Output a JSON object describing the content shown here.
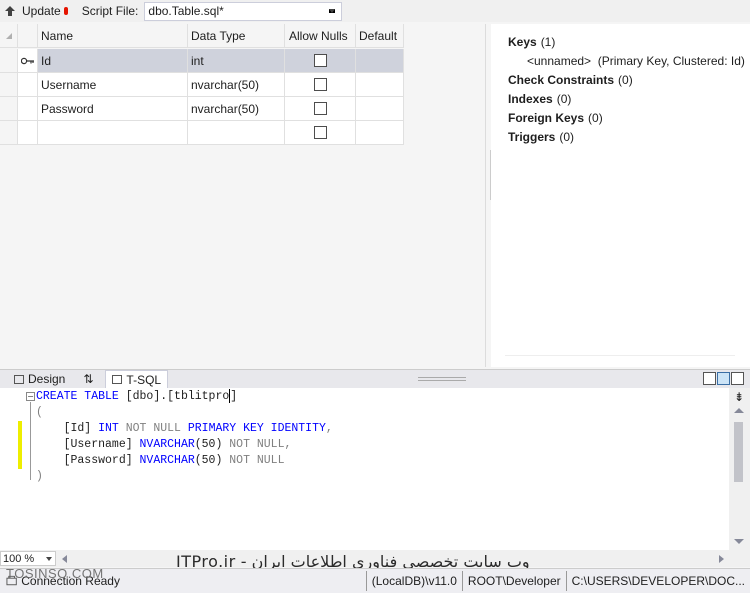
{
  "toolbar": {
    "update_label": "Update",
    "script_file_label": "Script File:",
    "script_file_value": "dbo.Table.sql*"
  },
  "grid": {
    "columns": [
      "Name",
      "Data Type",
      "Allow Nulls",
      "Default"
    ],
    "rows": [
      {
        "name": "Id",
        "type": "int",
        "allow_nulls": false,
        "default": "",
        "primary_key": true,
        "selected": true
      },
      {
        "name": "Username",
        "type": "nvarchar(50)",
        "allow_nulls": false,
        "default": ""
      },
      {
        "name": "Password",
        "type": "nvarchar(50)",
        "allow_nulls": false,
        "default": ""
      },
      {
        "name": "",
        "type": "",
        "allow_nulls": false,
        "default": ""
      }
    ]
  },
  "properties": {
    "keys_label": "Keys",
    "keys_count": "(1)",
    "key_item": "<unnamed>  (Primary Key, Clustered: Id)",
    "check_label": "Check Constraints",
    "check_count": "(0)",
    "indexes_label": "Indexes",
    "indexes_count": "(0)",
    "fk_label": "Foreign Keys",
    "fk_count": "(0)",
    "triggers_label": "Triggers",
    "triggers_count": "(0)"
  },
  "tabs": {
    "design": "Design",
    "swap": "⇅",
    "tsql": "T-SQL"
  },
  "editor": {
    "l1_kw": "CREATE TABLE",
    "l1_rest": " [dbo].[tblitpro",
    "l1_end": "]",
    "l2": "(",
    "l3_a": "    [Id] ",
    "l3_kw1": "INT",
    "l3_gray": " NOT NULL ",
    "l3_kw2": "PRIMARY KEY IDENTITY",
    "l3_end": ",",
    "l4_a": "    [Username] ",
    "l4_kw": "NVARCHAR",
    "l4_b": "(50) ",
    "l4_gray": "NOT NULL",
    "l4_end": ",",
    "l5_a": "    [Password] ",
    "l5_kw": "NVARCHAR",
    "l5_b": "(50) ",
    "l5_gray": "NOT NULL",
    "l6": ")"
  },
  "zoom": "100 %",
  "watermark": "وب سایت تخصصی فناوری اطلاعات ایران - ITPro.ir",
  "watermark2": "TOSINSO.COM",
  "status": {
    "connection": "Connection Ready",
    "server": "(LocalDB)\\v11.0",
    "user": "ROOT\\Developer",
    "path": "C:\\USERS\\DEVELOPER\\DOC..."
  }
}
